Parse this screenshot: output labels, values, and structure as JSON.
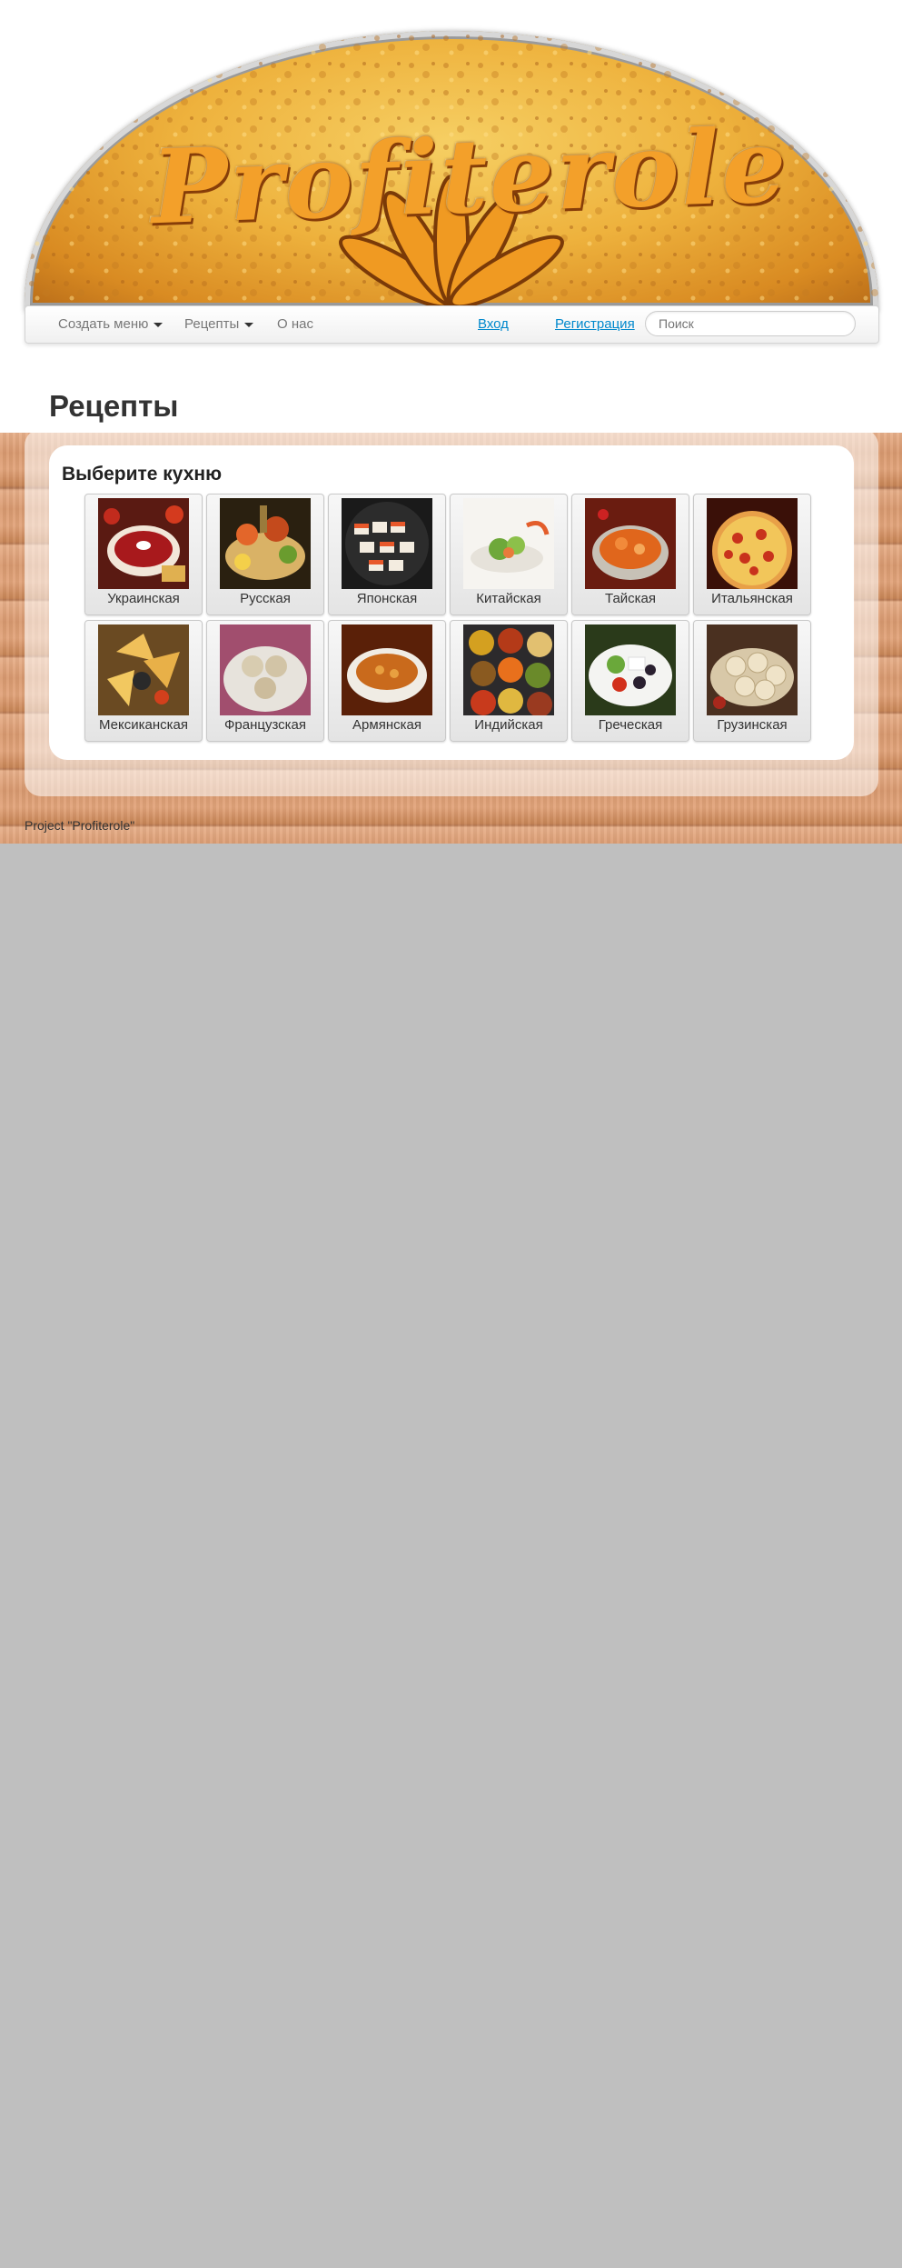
{
  "header": {
    "logo_text": "Profiterole"
  },
  "nav": {
    "create_menu": "Создать меню",
    "recipes": "Рецепты",
    "about": "О нас",
    "login": "Вход",
    "register": "Регистрация",
    "search_placeholder": "Поиск"
  },
  "page_title": "Рецепты",
  "panel": {
    "heading": "Выберите кухню",
    "cuisines": [
      {
        "label": "Украинская",
        "icon": "borscht-image"
      },
      {
        "label": "Русская",
        "icon": "russian-feast-image"
      },
      {
        "label": "Японская",
        "icon": "sushi-image"
      },
      {
        "label": "Китайская",
        "icon": "chinese-salad-image"
      },
      {
        "label": "Тайская",
        "icon": "thai-soup-image"
      },
      {
        "label": "Итальянская",
        "icon": "pizza-image"
      },
      {
        "label": "Мексиканская",
        "icon": "nachos-image"
      },
      {
        "label": "Французская",
        "icon": "french-dish-image"
      },
      {
        "label": "Армянская",
        "icon": "armenian-soup-image"
      },
      {
        "label": "Индийская",
        "icon": "spices-image"
      },
      {
        "label": "Греческая",
        "icon": "greek-salad-image"
      },
      {
        "label": "Грузинская",
        "icon": "khinkali-image"
      }
    ]
  },
  "footer": {
    "text": "Project \"Profiterole\""
  },
  "colors": {
    "link": "#0088cc",
    "background": "#bfbfbf",
    "banner": "#eeb23d"
  }
}
